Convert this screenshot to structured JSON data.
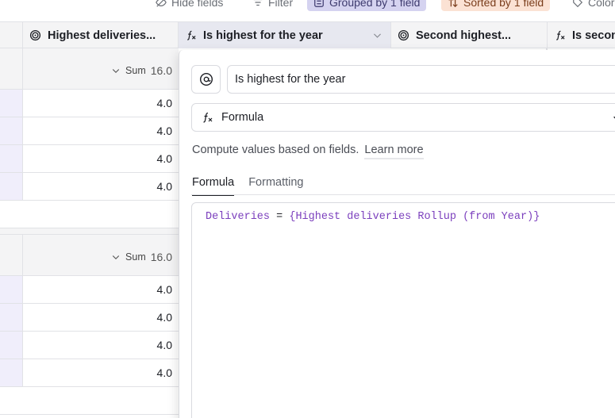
{
  "toolbar": {
    "hide_fields": "Hide fields",
    "filter": "Filter",
    "grouped": "Grouped by 1 field",
    "sorted": "Sorted by 1 field",
    "color": "Color",
    "group_color": "#d5d3f0",
    "sort_color": "#fbe2d4"
  },
  "columns": [
    {
      "name": "Highest deliveries...",
      "icon": "rollup-icon"
    },
    {
      "name": "Is highest for the year",
      "icon": "formula-icon"
    },
    {
      "name": "Second highest...",
      "icon": "rollup-icon"
    },
    {
      "name": "Is secon",
      "icon": "formula-icon"
    }
  ],
  "groups": [
    {
      "sum_label": "Sum",
      "sum_value": "16.0",
      "values": [
        "4.0",
        "4.0",
        "4.0",
        "4.0"
      ]
    },
    {
      "sum_label": "Sum",
      "sum_value": "16.0",
      "values": [
        "4.0",
        "4.0",
        "4.0",
        "4.0"
      ]
    }
  ],
  "panel": {
    "field_name": "Is highest for the year",
    "field_type": "Formula",
    "description": "Compute values based on fields.",
    "learn_more": "Learn more",
    "tabs": [
      "Formula",
      "Formatting"
    ],
    "active_tab": "Formula",
    "formula": {
      "field": "Deliveries",
      "operator": "=",
      "reference": "{Highest deliveries Rollup (from Year)}"
    }
  }
}
